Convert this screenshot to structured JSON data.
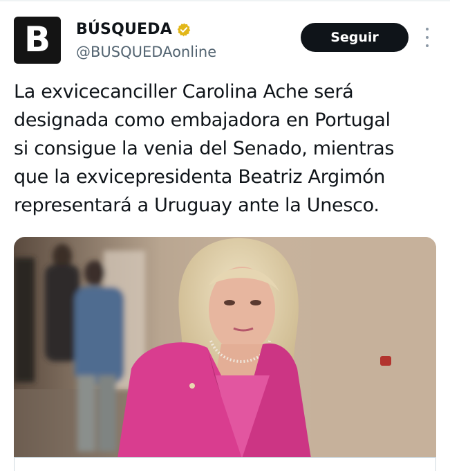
{
  "account": {
    "avatar_letter": "B",
    "display_name": "BÚSQUEDA",
    "verified_badge": "gold-verified-icon",
    "handle": "@BUSQUEDAonline"
  },
  "actions": {
    "follow_label": "Seguir",
    "more_icon": "more-vertical-icon"
  },
  "tweet": {
    "lines": [
      "La exvicecanciller Carolina Ache será",
      "designada como embajadora en Portugal",
      "si consigue la venia del Senado, mientras",
      "que la exvicepresidenta Beatriz Argimón",
      "representará a Uruguay ante la Unesco."
    ]
  },
  "colors": {
    "background": "#ffffff",
    "text_primary": "#0f1419",
    "text_secondary": "#536471",
    "button_bg": "#0f1419",
    "verified_gold": "#e2b719",
    "jacket_pink": "#d93d8f"
  }
}
